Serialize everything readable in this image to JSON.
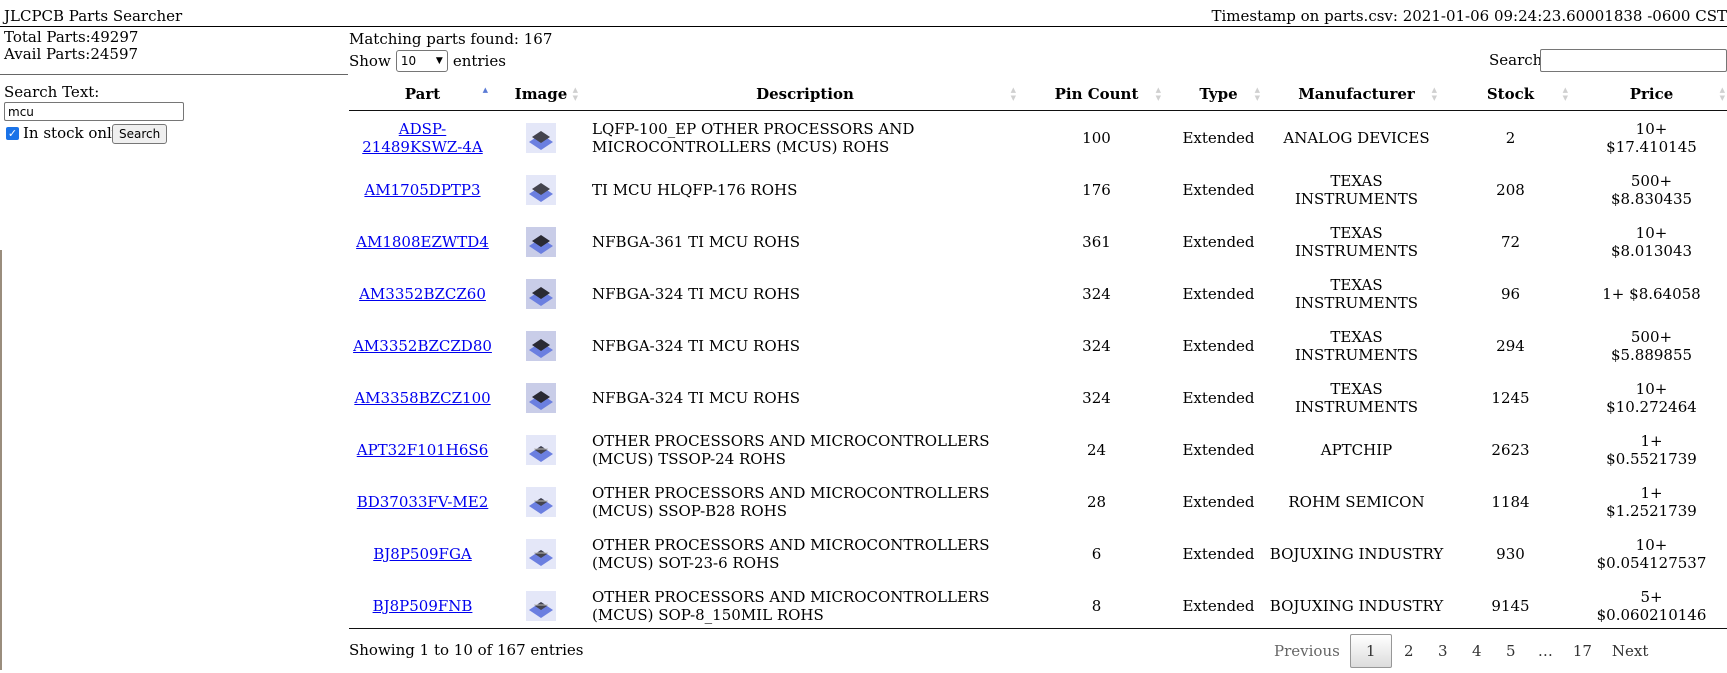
{
  "header": {
    "title": "JLCPCB Parts Searcher",
    "timestamp": "Timestamp on parts.csv: 2021-01-06 09:24:23.60001838 -0600 CST"
  },
  "sidebar": {
    "total_parts": "Total Parts:49297",
    "avail_parts": "Avail Parts:24597",
    "search_label": "Search Text:",
    "search_value": "mcu",
    "in_stock_label": "In stock only",
    "in_stock_checked": true,
    "search_button": "Search"
  },
  "results": {
    "matching": "Matching parts found: 167",
    "show_label": "Show",
    "entries_label": "entries",
    "page_size": "10",
    "search_label": "Search:",
    "search_value": ""
  },
  "table": {
    "columns": [
      "Part",
      "Image",
      "Description",
      "Pin Count",
      "Type",
      "Manufacturer",
      "Stock",
      "Price"
    ],
    "sorted_column": "Part",
    "rows": [
      {
        "part": "ADSP-21489KSWZ-4A",
        "desc": "LQFP-100_EP OTHER PROCESSORS AND MICROCONTROLLERS (MCUS) ROHS",
        "pins": "100",
        "type": "Extended",
        "mfr": "ANALOG DEVICES",
        "stock": "2",
        "price": "10+ $17.410145",
        "icon": "qfp-chip-icon"
      },
      {
        "part": "AM1705DPTP3",
        "desc": "TI MCU HLQFP-176 ROHS",
        "pins": "176",
        "type": "Extended",
        "mfr": "TEXAS INSTRUMENTS",
        "stock": "208",
        "price": "500+ $8.830435",
        "icon": "qfp-chip-icon"
      },
      {
        "part": "AM1808EZWTD4",
        "desc": "NFBGA-361 TI MCU ROHS",
        "pins": "361",
        "type": "Extended",
        "mfr": "TEXAS INSTRUMENTS",
        "stock": "72",
        "price": "10+ $8.013043",
        "icon": "bga-chip-icon"
      },
      {
        "part": "AM3352BZCZ60",
        "desc": "NFBGA-324 TI MCU ROHS",
        "pins": "324",
        "type": "Extended",
        "mfr": "TEXAS INSTRUMENTS",
        "stock": "96",
        "price": "1+ $8.64058",
        "icon": "bga-chip-icon"
      },
      {
        "part": "AM3352BZCZD80",
        "desc": "NFBGA-324 TI MCU ROHS",
        "pins": "324",
        "type": "Extended",
        "mfr": "TEXAS INSTRUMENTS",
        "stock": "294",
        "price": "500+ $5.889855",
        "icon": "bga-chip-icon"
      },
      {
        "part": "AM3358BZCZ100",
        "desc": "NFBGA-324 TI MCU ROHS",
        "pins": "324",
        "type": "Extended",
        "mfr": "TEXAS INSTRUMENTS",
        "stock": "1245",
        "price": "10+ $10.272464",
        "icon": "bga-chip-icon"
      },
      {
        "part": "APT32F101H6S6",
        "desc": "OTHER PROCESSORS AND MICROCONTROLLERS (MCUS) TSSOP-24 ROHS",
        "pins": "24",
        "type": "Extended",
        "mfr": "APTCHIP",
        "stock": "2623",
        "price": "1+ $0.5521739",
        "icon": "tssop-chip-icon"
      },
      {
        "part": "BD37033FV-ME2",
        "desc": "OTHER PROCESSORS AND MICROCONTROLLERS (MCUS) SSOP-B28 ROHS",
        "pins": "28",
        "type": "Extended",
        "mfr": "ROHM SEMICON",
        "stock": "1184",
        "price": "1+ $1.2521739",
        "icon": "ssop-chip-icon"
      },
      {
        "part": "BJ8P509FGA",
        "desc": "OTHER PROCESSORS AND MICROCONTROLLERS (MCUS) SOT-23-6 ROHS",
        "pins": "6",
        "type": "Extended",
        "mfr": "BOJUXING INDUSTRY",
        "stock": "930",
        "price": "10+ $0.054127537",
        "icon": "sot-chip-icon"
      },
      {
        "part": "BJ8P509FNB",
        "desc": "OTHER PROCESSORS AND MICROCONTROLLERS (MCUS) SOP-8_150MIL ROHS",
        "pins": "8",
        "type": "Extended",
        "mfr": "BOJUXING INDUSTRY",
        "stock": "9145",
        "price": "5+ $0.060210146",
        "icon": "sop-chip-icon"
      }
    ]
  },
  "footer": {
    "showing": "Showing 1 to 10 of 167 entries",
    "previous": "Previous",
    "next": "Next",
    "pages": [
      "1",
      "2",
      "3",
      "4",
      "5",
      "…",
      "17"
    ],
    "current_page": "1"
  },
  "colors": {
    "link": "#0000ee",
    "sort_active": "#5b7bd5",
    "chip_tile": "#6b7fe0"
  }
}
